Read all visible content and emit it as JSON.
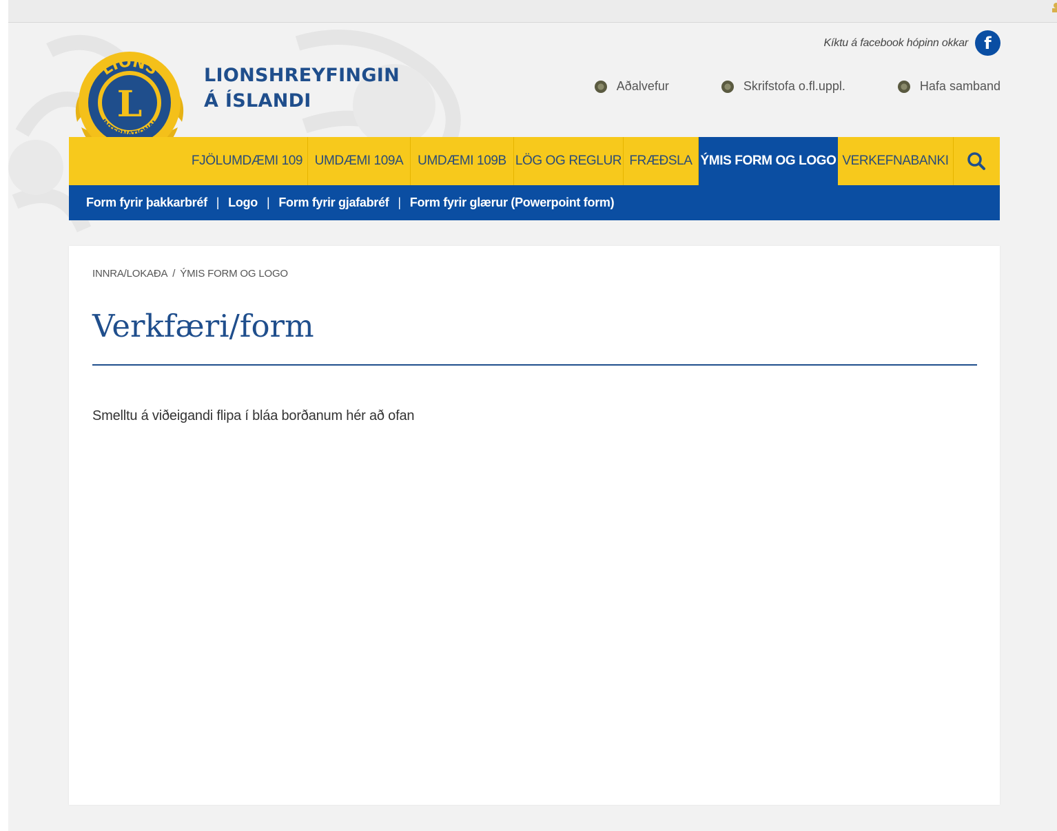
{
  "header": {
    "site_name_line1": "LIONSHREYFINGIN",
    "site_name_line2": "Á ÍSLANDI",
    "logo_icon": "lions-international-logo",
    "facebook_text": "Kíktu á facebook hópinn okkar",
    "facebook_icon_glyph": "f",
    "top_links": [
      "Aðalvefur",
      "Skrifstofa o.fl.uppl.",
      "Hafa samband"
    ]
  },
  "nav": {
    "items": [
      {
        "label": "FJÖLUMDÆMI 109"
      },
      {
        "label": "UMDÆMI 109A"
      },
      {
        "label": "UMDÆMI 109B"
      },
      {
        "label": "LÖG OG REGLUR"
      },
      {
        "label": "FRÆÐSLA"
      },
      {
        "label": "ÝMIS FORM OG LOGO",
        "active": true
      },
      {
        "label": "VERKEFNABANKI"
      }
    ],
    "search_icon": "search-icon"
  },
  "subnav": {
    "items": [
      "Form fyrir þakkarbréf",
      "Logo",
      "Form fyrir gjafabréf",
      "Form fyrir glærur (Powerpoint form)"
    ],
    "separator": "|"
  },
  "content": {
    "breadcrumb": [
      "INNRA/LOKAÐA",
      "ÝMIS FORM OG LOGO"
    ],
    "breadcrumb_separator": "/",
    "title": "Verkfæri/form",
    "body": "Smelltu á viðeigandi flipa í bláa borðanum hér að ofan"
  },
  "colors": {
    "brand_blue": "#0b4ea2",
    "brand_yellow": "#f7c91c",
    "title_blue": "#1f4e8c"
  }
}
